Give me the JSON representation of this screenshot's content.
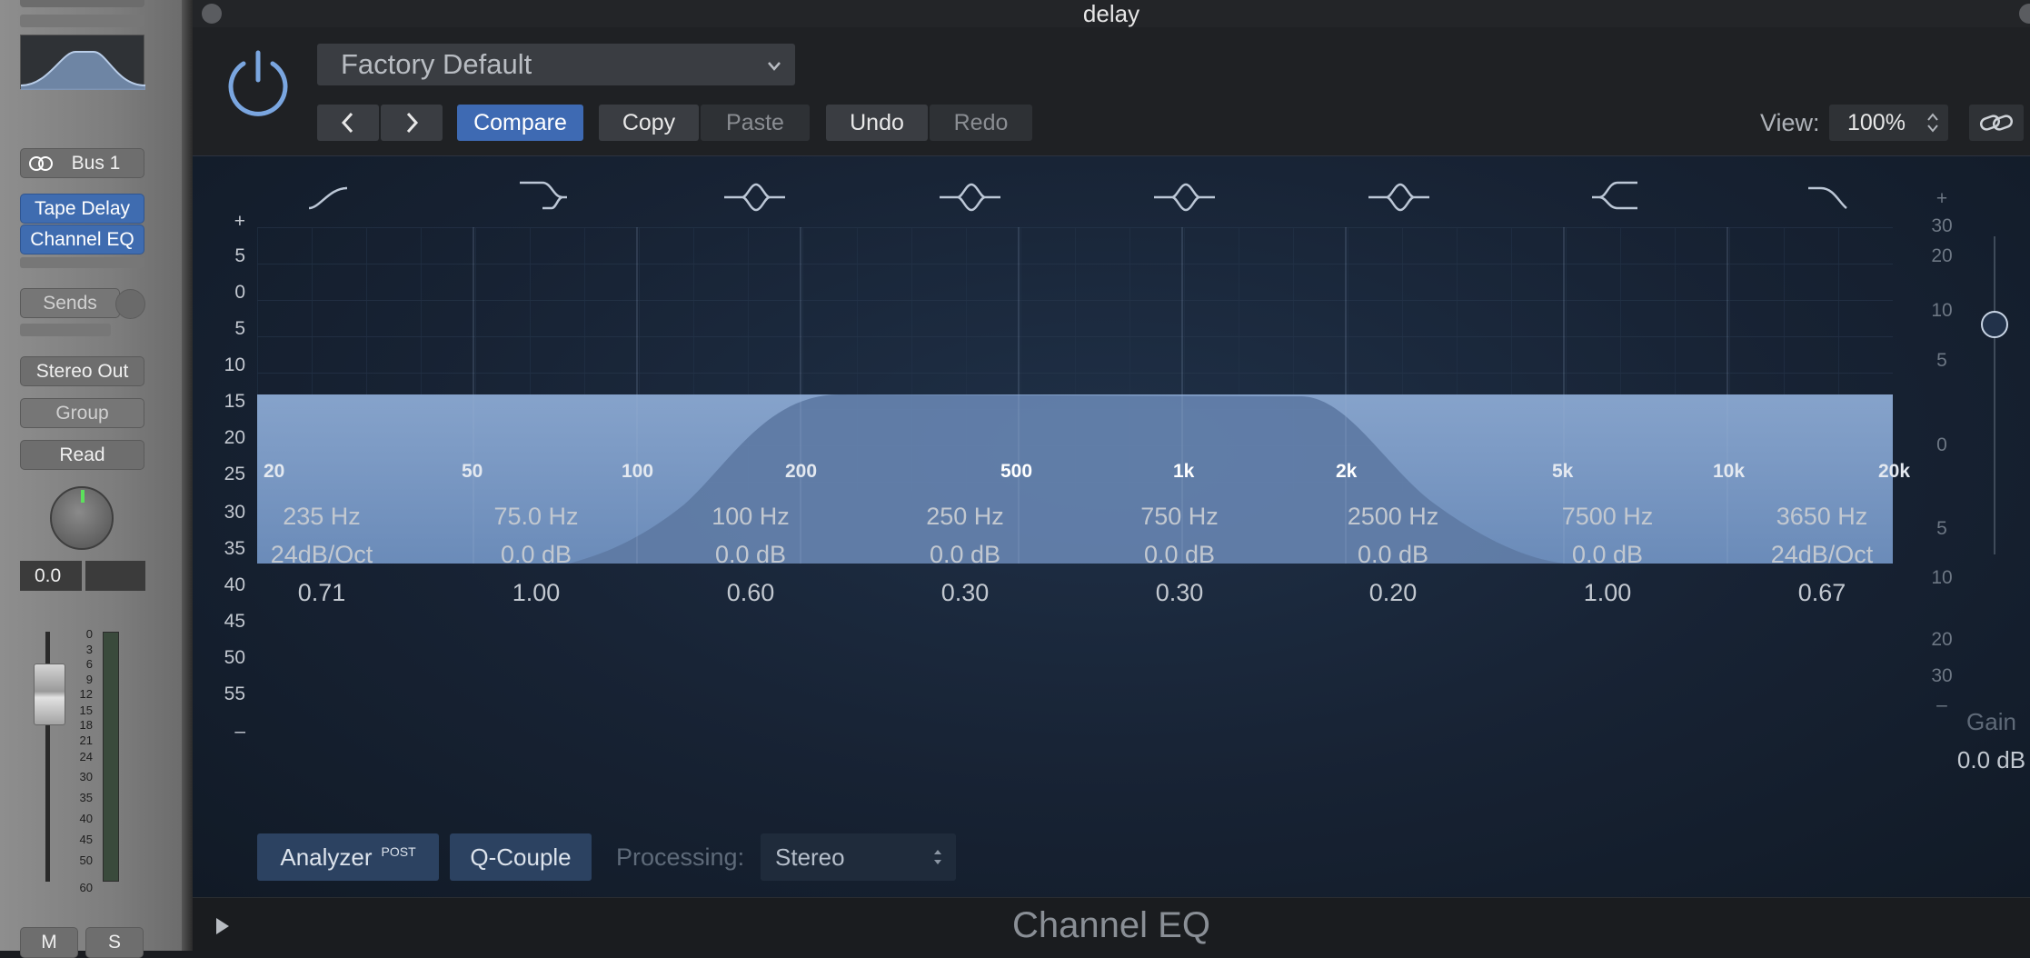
{
  "window": {
    "title": "delay"
  },
  "strip": {
    "bus": "Bus 1",
    "inserts": [
      "Tape Delay",
      "Channel EQ"
    ],
    "sends_label": "Sends",
    "output": "Stereo Out",
    "group": "Group",
    "automation": "Read",
    "volume_readout": "0.0",
    "fader_scale": [
      "0",
      "3",
      "6",
      "9",
      "12",
      "15",
      "18",
      "21",
      "24",
      "30",
      "35",
      "40",
      "45",
      "50",
      "60"
    ],
    "mute_label": "M",
    "solo_label": "S"
  },
  "toolbar": {
    "preset": "Factory Default",
    "compare": "Compare",
    "copy": "Copy",
    "paste": "Paste",
    "undo": "Undo",
    "redo": "Redo",
    "view_label": "View:",
    "view_value": "100%"
  },
  "eq": {
    "left_scale": [
      "+",
      "5",
      "0",
      "5",
      "10",
      "15",
      "20",
      "25",
      "30",
      "35",
      "40",
      "45",
      "50",
      "55",
      "–"
    ],
    "right_scale": [
      "+",
      "30",
      "20",
      "10",
      "5",
      "0",
      "5",
      "10",
      "20",
      "30",
      "–"
    ],
    "freq_labels": [
      "20",
      "50",
      "100",
      "200",
      "500",
      "1k",
      "2k",
      "5k",
      "10k",
      "20k"
    ],
    "bands": [
      {
        "freq": "235 Hz",
        "gain": "24dB/Oct",
        "q": "0.71"
      },
      {
        "freq": "75.0 Hz",
        "gain": "0.0 dB",
        "q": "1.00"
      },
      {
        "freq": "100 Hz",
        "gain": "0.0 dB",
        "q": "0.60"
      },
      {
        "freq": "250 Hz",
        "gain": "0.0 dB",
        "q": "0.30"
      },
      {
        "freq": "750 Hz",
        "gain": "0.0 dB",
        "q": "0.30"
      },
      {
        "freq": "2500 Hz",
        "gain": "0.0 dB",
        "q": "0.20"
      },
      {
        "freq": "7500 Hz",
        "gain": "0.0 dB",
        "q": "1.00"
      },
      {
        "freq": "3650 Hz",
        "gain": "24dB/Oct",
        "q": "0.67"
      }
    ],
    "gain_label": "Gain",
    "gain_value": "0.0 dB",
    "analyzer": "Analyzer",
    "analyzer_badge": "POST",
    "q_couple": "Q-Couple",
    "processing_label": "Processing:",
    "processing_value": "Stereo"
  },
  "footer": {
    "plugin_name": "Channel EQ"
  },
  "colors": {
    "accent": "#3e6ab3",
    "curve_fill": "#7f9dc6",
    "power": "#7aa6e0"
  }
}
